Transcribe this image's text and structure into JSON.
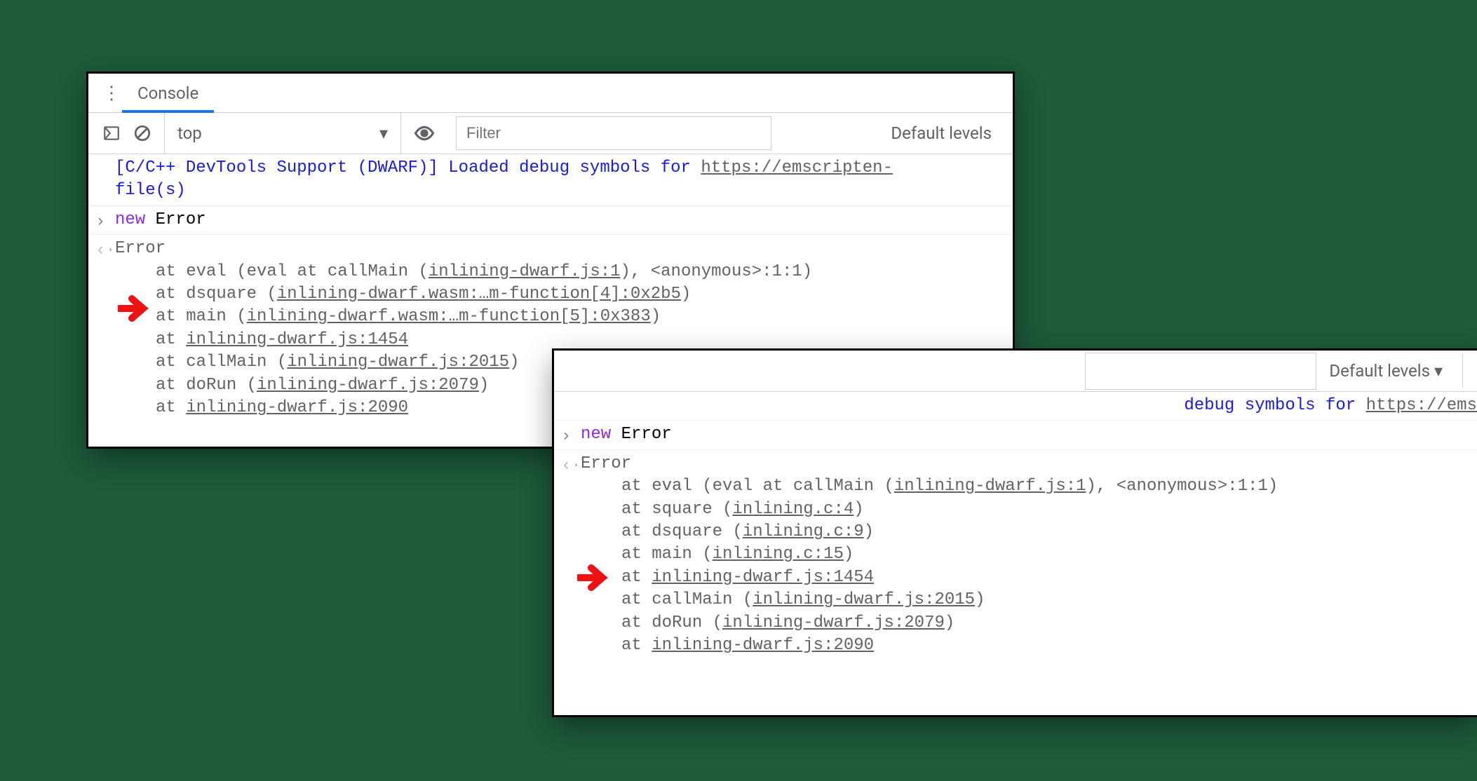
{
  "panel1": {
    "tab": "Console",
    "context": "top",
    "filter_placeholder": "Filter",
    "levels": "Default levels",
    "log": {
      "prefix": "[C/C++ DevTools Support (DWARF)]",
      "message": " Loaded debug symbols for ",
      "link": "https://emscripten-",
      "line2": "file(s)"
    },
    "input": {
      "new": "new",
      "error": " Error"
    },
    "error_title": "Error",
    "trace": [
      {
        "label": "at eval (eval at callMain (",
        "link": "inlining-dwarf.js:1",
        "suffix": "), <anonymous>:1:1)"
      },
      {
        "label": "at dsquare (",
        "link": "inlining-dwarf.wasm:…m-function[4]:0x2b5",
        "suffix": ")"
      },
      {
        "label": "at main (",
        "link": "inlining-dwarf.wasm:…m-function[5]:0x383",
        "suffix": ")"
      },
      {
        "label": "at ",
        "link": "inlining-dwarf.js:1454",
        "suffix": ""
      },
      {
        "label": "at callMain (",
        "link": "inlining-dwarf.js:2015",
        "suffix": ")"
      },
      {
        "label": "at doRun (",
        "link": "inlining-dwarf.js:2079",
        "suffix": ")"
      },
      {
        "label": "at ",
        "link": "inlining-dwarf.js:2090",
        "suffix": ""
      }
    ]
  },
  "panel2": {
    "levels": "Default levels",
    "log": {
      "message": "debug symbols for ",
      "link": "https://ems"
    },
    "input": {
      "new": "new",
      "error": " Error"
    },
    "error_title": "Error",
    "trace": [
      {
        "label": "at eval (eval at callMain (",
        "link": "inlining-dwarf.js:1",
        "suffix": "), <anonymous>:1:1)"
      },
      {
        "label": "at square (",
        "link": "inlining.c:4",
        "suffix": ")"
      },
      {
        "label": "at dsquare (",
        "link": "inlining.c:9",
        "suffix": ")"
      },
      {
        "label": "at main (",
        "link": "inlining.c:15",
        "suffix": ")"
      },
      {
        "label": "at ",
        "link": "inlining-dwarf.js:1454",
        "suffix": ""
      },
      {
        "label": "at callMain (",
        "link": "inlining-dwarf.js:2015",
        "suffix": ")"
      },
      {
        "label": "at doRun (",
        "link": "inlining-dwarf.js:2079",
        "suffix": ")"
      },
      {
        "label": "at ",
        "link": "inlining-dwarf.js:2090",
        "suffix": ""
      }
    ]
  }
}
